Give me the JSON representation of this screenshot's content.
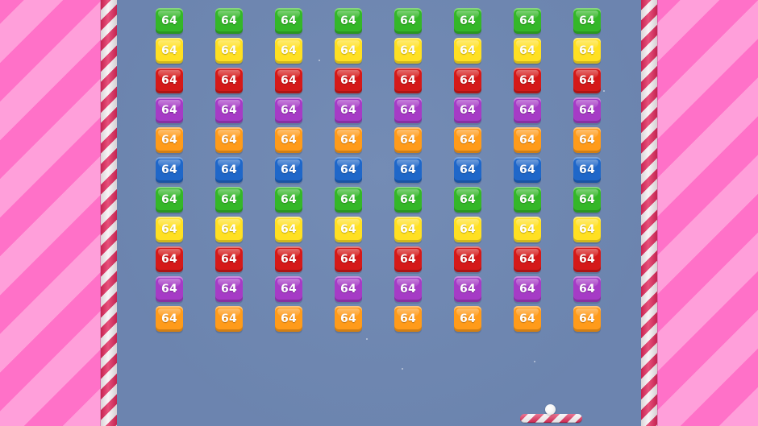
{
  "game": {
    "brick_value": "64",
    "columns": 8,
    "rows": 11,
    "row_colors": [
      "#34b728",
      "#ffe022",
      "#d51919",
      "#a63bc6",
      "#ff9b1a",
      "#1f67c9",
      "#34b728",
      "#ffe022",
      "#d51919",
      "#a63bc6",
      "#ff9b1a"
    ],
    "paddle_icon": "candy-cane-paddle",
    "ball_icon": "white-ball"
  }
}
